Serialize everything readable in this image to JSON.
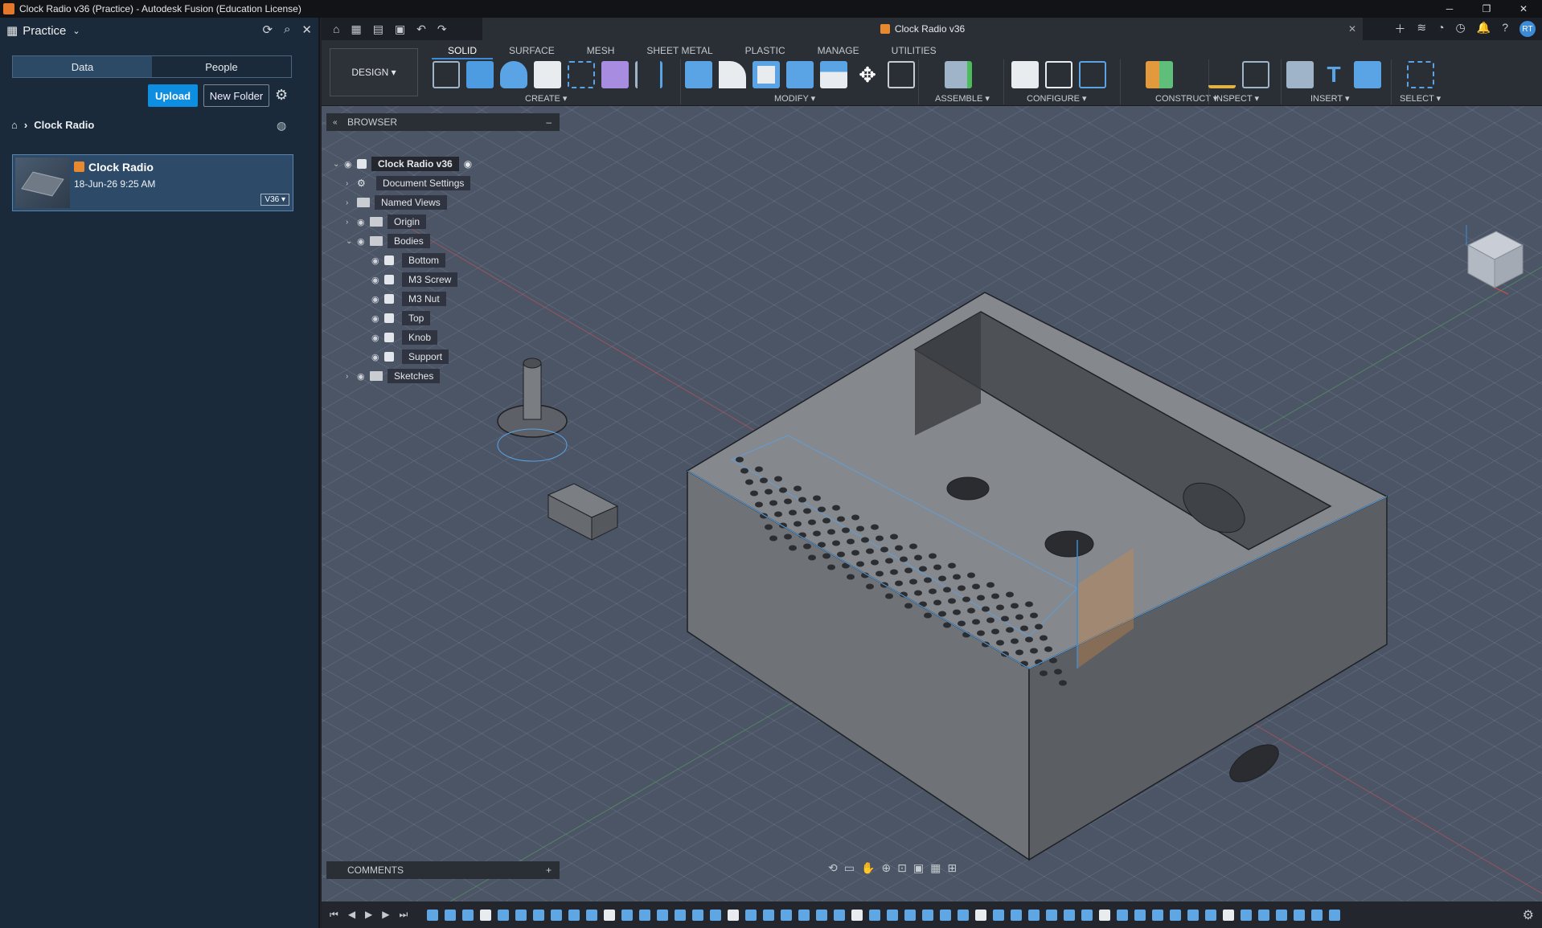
{
  "window": {
    "title": "Clock Radio v36 (Practice) - Autodesk Fusion (Education License)"
  },
  "data_panel": {
    "project": "Practice",
    "tabs": [
      "Data",
      "People"
    ],
    "upload_label": "Upload",
    "new_folder_label": "New Folder",
    "breadcrumb": "Clock Radio",
    "file": {
      "name": "Clock Radio",
      "date": "18-Jun-26 9:25 AM",
      "version": "V36 ▾"
    }
  },
  "document_tab": {
    "title": "Clock Radio v36"
  },
  "avatar_initials": "RT",
  "ribbon": {
    "workspace_button": "DESIGN ▾",
    "tabs": [
      "SOLID",
      "SURFACE",
      "MESH",
      "SHEET METAL",
      "PLASTIC",
      "MANAGE",
      "UTILITIES"
    ],
    "groups": [
      "CREATE ▾",
      "MODIFY ▾",
      "ASSEMBLE ▾",
      "CONFIGURE ▾",
      "CONSTRUCT ▾",
      "INSPECT ▾",
      "INSERT ▾",
      "SELECT ▾"
    ]
  },
  "browser": {
    "title": "BROWSER",
    "root": "Clock Radio v36",
    "items": [
      "Document Settings",
      "Named Views",
      "Origin",
      "Bodies"
    ],
    "bodies": [
      "Bottom",
      "M3 Screw",
      "M3 Nut",
      "Top",
      "Knob",
      "Support"
    ],
    "sketches": "Sketches"
  },
  "comments_label": "COMMENTS",
  "colors": {
    "accent": "#0e8ee0",
    "selection": "#3d8bd6",
    "body": "#6b6e73"
  }
}
